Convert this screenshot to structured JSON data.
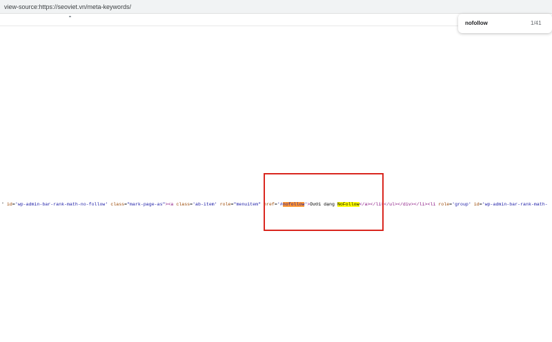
{
  "browser": {
    "address_text": "view-source:https://seoviet.vn/meta-keywords/"
  },
  "find_bar": {
    "query": "nofollow",
    "match_count": "1/41"
  },
  "source_line": {
    "seg_01": "' ",
    "seg_02": "id",
    "seg_03": "=",
    "seg_04": "'wp-admin-bar-rank-math-no-follow'",
    "seg_05": " ",
    "seg_06": "class",
    "seg_07": "=",
    "seg_08": "\"mark-page-as\"",
    "seg_09": "><a ",
    "seg_10": "class",
    "seg_11": "=",
    "seg_12": "'ab-item'",
    "seg_13": " ",
    "seg_14": "role",
    "seg_15": "=",
    "seg_16": "\"menuitem\"",
    "seg_17": " ",
    "seg_18": "href",
    "seg_19": "=",
    "seg_20": "'#",
    "seg_21": "nofollow",
    "seg_22": "'",
    "seg_23": ">",
    "seg_24": "Dưới dạng ",
    "seg_25": "NoFollow",
    "seg_26": "</a></li></ul></div></li><li ",
    "seg_27": "role",
    "seg_28": "=",
    "seg_29": "'group'",
    "seg_30": " ",
    "seg_31": "id",
    "seg_32": "=",
    "seg_33": "'wp-admin-bar-rank-math-"
  },
  "colors": {
    "annotation_box": "#d9251d",
    "active_match_highlight": "#ff9632",
    "match_highlight": "#ffff00"
  }
}
